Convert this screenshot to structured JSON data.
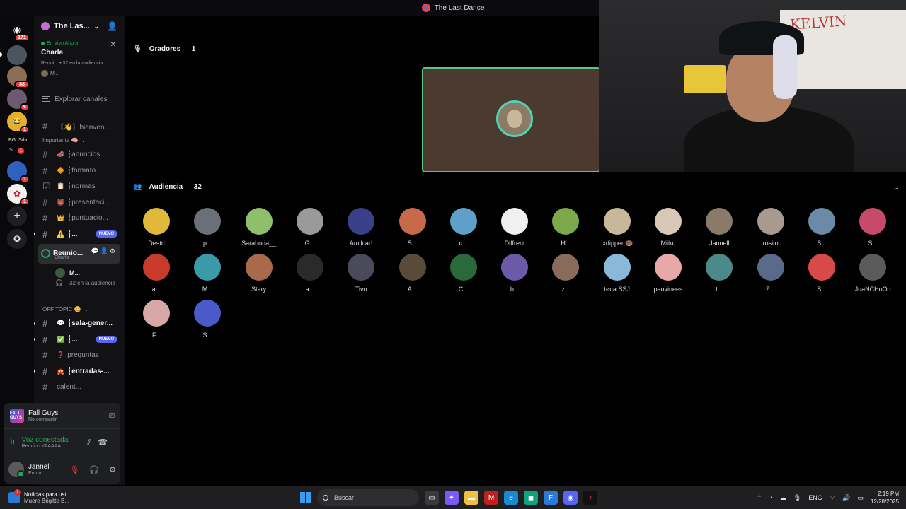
{
  "window": {
    "title": "The Last Dance"
  },
  "rail": {
    "servers": [
      {
        "name": "home",
        "badge": "171",
        "color": "#2b2d31",
        "glyph": "◉"
      },
      {
        "name": "server-1",
        "badge": "",
        "color": "#4a5560",
        "glyph": ""
      },
      {
        "name": "server-2",
        "badge": "88",
        "color": "#8a6e56",
        "glyph": ""
      },
      {
        "name": "server-3",
        "badge": "6",
        "color": "#6b5a70",
        "glyph": ""
      },
      {
        "name": "server-4",
        "badge": "1",
        "color": "#e6b02e",
        "glyph": "😂"
      },
      {
        "name": "server-5",
        "badge": "1",
        "color": "#3060c0",
        "glyph": ""
      },
      {
        "name": "server-6",
        "badge": "1",
        "color": "#f2f2f2",
        "glyph": ""
      }
    ],
    "folder_labels": [
      "BG",
      "Sda",
      "S",
      "S"
    ]
  },
  "sidebar": {
    "server_name": "The Las...",
    "live": {
      "status": "En Vivo Ahora",
      "topic": "Charla",
      "meta": "Reuni... • 32 en la audiencia",
      "speaker": "M..."
    },
    "explore": "Explorar canales",
    "channels_top": [
      {
        "emoji": "👋",
        "label": "〘👋〙bienveni..."
      }
    ],
    "category_1": "Importante 🧠",
    "channels": [
      {
        "emoji": "📣",
        "label": "┆anuncios",
        "bold": false,
        "new": false,
        "hash": "#"
      },
      {
        "emoji": "🔶",
        "label": "┆formato",
        "bold": false,
        "new": false,
        "hash": "#"
      },
      {
        "emoji": "📋",
        "label": "┆normas",
        "bold": false,
        "new": false,
        "hash": "☑"
      },
      {
        "emoji": "👹",
        "label": "┆presentaci...",
        "bold": false,
        "new": false,
        "hash": "#"
      },
      {
        "emoji": "👑",
        "label": "┆puntuacio...",
        "bold": false,
        "new": false,
        "hash": "#"
      },
      {
        "emoji": "⚠️",
        "label": "┆...",
        "bold": true,
        "new": true,
        "hash": "#"
      }
    ],
    "voice_channel": {
      "name": "Reunio...",
      "sub": "Charla",
      "user": "M...",
      "audience": "32 en la audiencia"
    },
    "category_2": "OFF TOPIC 😋",
    "channels_2": [
      {
        "emoji": "💬",
        "label": "┆sala-gener...",
        "bold": true,
        "new": false,
        "hash": "#"
      },
      {
        "emoji": "✅",
        "label": "┆...",
        "bold": true,
        "new": true,
        "hash": "#"
      },
      {
        "emoji": "❓",
        "label": "preguntas",
        "bold": false,
        "new": false,
        "hash": "#"
      },
      {
        "emoji": "🎪",
        "label": "┆entradas-...",
        "bold": true,
        "new": false,
        "hash": "#"
      },
      {
        "emoji": "",
        "label": "calent...",
        "bold": false,
        "new": false,
        "hash": "#"
      }
    ],
    "new_label": "NUEVO"
  },
  "activity": {
    "game": "Fall Guys",
    "status": "No compartir",
    "icon_text": "FALL GUYS"
  },
  "voice": {
    "status": "Voz conectada",
    "channel": "Reunion YAAAAA..."
  },
  "user": {
    "name": "Jannell",
    "status": "En un ..."
  },
  "stage": {
    "speakers_title": "Oradores — 1",
    "audience_title": "Audiencia — 32",
    "audience": [
      {
        "name": "Destri",
        "color": "#e0b83a"
      },
      {
        "name": "p...",
        "color": "#6a6f78"
      },
      {
        "name": "Sarahoria__",
        "color": "#8fbf6a"
      },
      {
        "name": "G...",
        "color": "#9a9a9a"
      },
      {
        "name": "Amilcar!",
        "color": "#3a3f8a"
      },
      {
        "name": "S...",
        "color": "#c86a4a"
      },
      {
        "name": "c...",
        "color": "#5fa0c8"
      },
      {
        "name": "Diffrent",
        "color": "#f0f0f0"
      },
      {
        "name": "H...",
        "color": "#7aa84a"
      },
      {
        "name": ".xdipper 🍩",
        "color": "#c8b89a"
      },
      {
        "name": "Miiku",
        "color": "#d8c8b8"
      },
      {
        "name": "Jannell",
        "color": "#8a7a6a"
      },
      {
        "name": "rosito",
        "color": "#a89a90"
      },
      {
        "name": "S...",
        "color": "#6a8aa8"
      },
      {
        "name": "S...",
        "color": "#c84a6a"
      },
      {
        "name": "a...",
        "color": "#c83a2a"
      },
      {
        "name": "M...",
        "color": "#3a9aa8"
      },
      {
        "name": "Stary",
        "color": "#a86a4a"
      },
      {
        "name": "a...",
        "color": "#2a2a2a"
      },
      {
        "name": "Tivo",
        "color": "#4a4a5a"
      },
      {
        "name": "A...",
        "color": "#5a4a3a"
      },
      {
        "name": "C...",
        "color": "#2a6a3a"
      },
      {
        "name": "b...",
        "color": "#6a5aa8"
      },
      {
        "name": "z...",
        "color": "#8a6a5a"
      },
      {
        "name": "tøca SSJ",
        "color": "#8ab8d8"
      },
      {
        "name": "pauvinees",
        "color": "#e8a8a8"
      },
      {
        "name": "t...",
        "color": "#4a8a8a"
      },
      {
        "name": "Z...",
        "color": "#5a6a8a"
      },
      {
        "name": "S...",
        "color": "#d84a4a"
      },
      {
        "name": "JuaNCHoOo",
        "color": "#5a5a5a"
      },
      {
        "name": "F...",
        "color": "#d8a8a8"
      },
      {
        "name": "S...",
        "color": "#4a5ac8"
      }
    ]
  },
  "webcam": {
    "board_text": "KELVIN"
  },
  "taskbar": {
    "news_title": "Noticias para ust...",
    "news_sub": "Muere Brigitte B...",
    "news_badge": "2",
    "search": "Buscar",
    "lang": "ENG",
    "time": "2:19 PM",
    "date": "12/28/2025"
  },
  "colors": {
    "accent": "#5865f2",
    "online": "#23a559",
    "danger": "#f23f43"
  }
}
